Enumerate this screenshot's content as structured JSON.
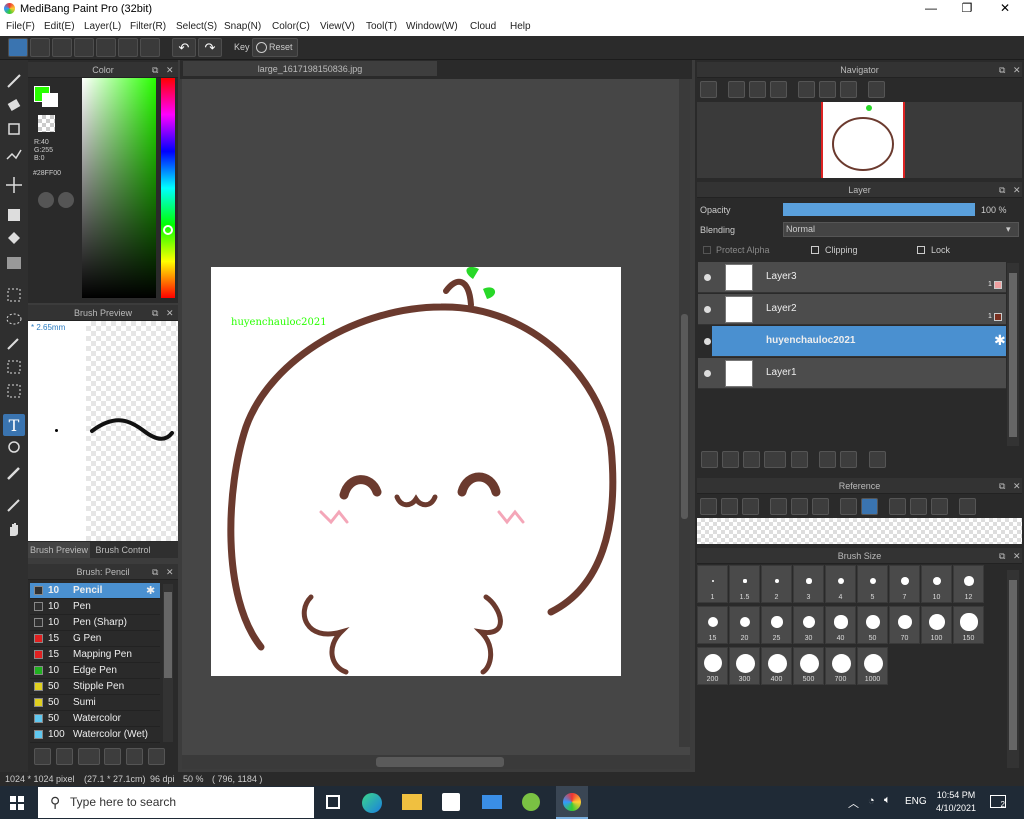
{
  "window": {
    "title": "MediBang Paint Pro (32bit)",
    "controls": [
      "—",
      "❐",
      "✕"
    ]
  },
  "menu": [
    "File(F)",
    "Edit(E)",
    "Layer(L)",
    "Filter(R)",
    "Select(S)",
    "Snap(N)",
    "Color(C)",
    "View(V)",
    "Tool(T)",
    "Window(W)",
    "Cloud",
    "Help"
  ],
  "toolbar": {
    "key_label": "Key",
    "reset_label": "Reset"
  },
  "color_panel": {
    "title": "Color",
    "r": "R:40",
    "g": "G:255",
    "b": "B:0",
    "hex": "#28FF00",
    "fg_color": "#28ff00"
  },
  "brush_preview": {
    "title": "Brush Preview",
    "size": "* 2.65mm",
    "tab1": "Brush Preview",
    "tab2": "Brush Control"
  },
  "brush_list": {
    "title": "Brush: Pencil",
    "items": [
      {
        "size": "10",
        "name": "Pencil",
        "color": "#303030",
        "selected": true
      },
      {
        "size": "10",
        "name": "Pen",
        "color": "#303030"
      },
      {
        "size": "10",
        "name": "Pen (Sharp)",
        "color": "#303030"
      },
      {
        "size": "15",
        "name": "G Pen",
        "color": "#e02020"
      },
      {
        "size": "15",
        "name": "Mapping Pen",
        "color": "#e02020"
      },
      {
        "size": "10",
        "name": "Edge Pen",
        "color": "#20b020"
      },
      {
        "size": "50",
        "name": "Stipple Pen",
        "color": "#e0d020"
      },
      {
        "size": "50",
        "name": "Sumi",
        "color": "#e0d020"
      },
      {
        "size": "50",
        "name": "Watercolor",
        "color": "#60c8f0"
      },
      {
        "size": "100",
        "name": "Watercolor (Wet)",
        "color": "#60c8f0"
      }
    ]
  },
  "document": {
    "tab": "large_1617198150836.jpg",
    "watermark": "huyenchauloc2021"
  },
  "navigator": {
    "title": "Navigator"
  },
  "layer_panel": {
    "title": "Layer",
    "opacity_label": "Opacity",
    "opacity_value": "100 %",
    "opacity": 1.0,
    "blending_label": "Blending",
    "blending_value": "Normal",
    "protect_alpha": "Protect Alpha",
    "clipping": "Clipping",
    "lock": "Lock",
    "layers": [
      {
        "name": "Layer3",
        "badge": "1",
        "badge_color": "#f0a0a0"
      },
      {
        "name": "Layer2",
        "badge": "1",
        "badge_color": "#7a3020"
      },
      {
        "name": "huyenchauloc2021",
        "selected": true
      },
      {
        "name": "Layer1"
      }
    ]
  },
  "reference": {
    "title": "Reference"
  },
  "brush_size": {
    "title": "Brush Size",
    "sizes": [
      "1",
      "1.5",
      "2",
      "3",
      "4",
      "5",
      "7",
      "10",
      "12",
      "15",
      "20",
      "25",
      "30",
      "40",
      "50",
      "70",
      "100",
      "150",
      "200",
      "300",
      "400",
      "500",
      "700",
      "1000"
    ]
  },
  "statusbar": {
    "dims": "1024 * 1024 pixel",
    "cm": "(27.1 * 27.1cm)",
    "dpi": "96 dpi",
    "zoom": "50 %",
    "coords": "( 796, 1184 )"
  },
  "taskbar": {
    "search_placeholder": "Type here to search",
    "lang": "ENG",
    "time": "10:54 PM",
    "date": "4/10/2021",
    "notif": "2"
  }
}
